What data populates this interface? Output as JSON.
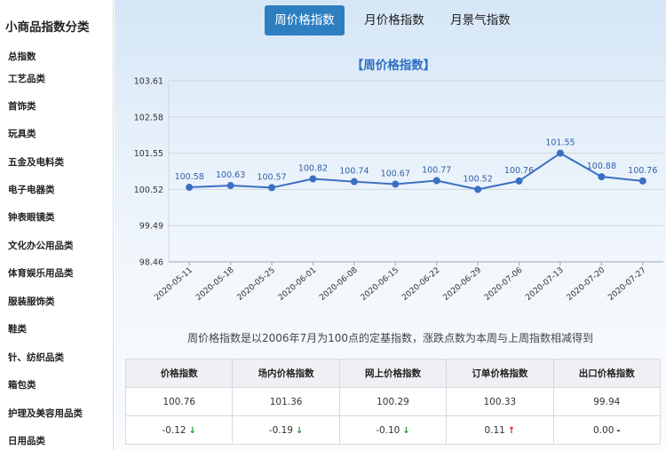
{
  "sidebar": {
    "title": "小商品指数分类",
    "items": [
      {
        "label": "总指数"
      },
      {
        "label": "工艺品类"
      },
      {
        "label": "首饰类"
      },
      {
        "label": "玩具类"
      },
      {
        "label": "五金及电料类"
      },
      {
        "label": "电子电器类"
      },
      {
        "label": "钟表眼镜类"
      },
      {
        "label": "文化办公用品类"
      },
      {
        "label": "体育娱乐用品类"
      },
      {
        "label": "服装服饰类"
      },
      {
        "label": "鞋类"
      },
      {
        "label": "针、纺织品类"
      },
      {
        "label": "箱包类"
      },
      {
        "label": "护理及美容用品类"
      },
      {
        "label": "日用品类"
      }
    ]
  },
  "tabs": [
    {
      "label": "周价格指数",
      "active": true
    },
    {
      "label": "月价格指数",
      "active": false
    },
    {
      "label": "月景气指数",
      "active": false
    }
  ],
  "chart_data": {
    "type": "line",
    "title": "【周价格指数】",
    "x": [
      "2020-05-11",
      "2020-05-18",
      "2020-05-25",
      "2020-06-01",
      "2020-06-08",
      "2020-06-15",
      "2020-06-22",
      "2020-06-29",
      "2020-07-06",
      "2020-07-13",
      "2020-07-20",
      "2020-07-27"
    ],
    "values": [
      100.58,
      100.63,
      100.57,
      100.82,
      100.74,
      100.67,
      100.77,
      100.52,
      100.76,
      101.55,
      100.88,
      100.76
    ],
    "ylim": [
      98.46,
      103.61
    ],
    "yticks": [
      "103.61",
      "102.58",
      "101.55",
      "100.52",
      "99.49",
      "98.46"
    ],
    "grid": true,
    "line_color": "#3a6fc4"
  },
  "note": "周价格指数是以2006年7月为100点的定基指数，涨跌点数为本周与上周指数相减得到",
  "table": {
    "headers": [
      "价格指数",
      "场内价格指数",
      "网上价格指数",
      "订单价格指数",
      "出口价格指数"
    ],
    "values": [
      "100.76",
      "101.36",
      "100.29",
      "100.33",
      "99.94"
    ],
    "changes": [
      {
        "value": "-0.12",
        "dir": "down"
      },
      {
        "value": "-0.19",
        "dir": "down"
      },
      {
        "value": "-0.10",
        "dir": "down"
      },
      {
        "value": "0.11",
        "dir": "up"
      },
      {
        "value": "0.00",
        "dir": "flat"
      }
    ]
  }
}
